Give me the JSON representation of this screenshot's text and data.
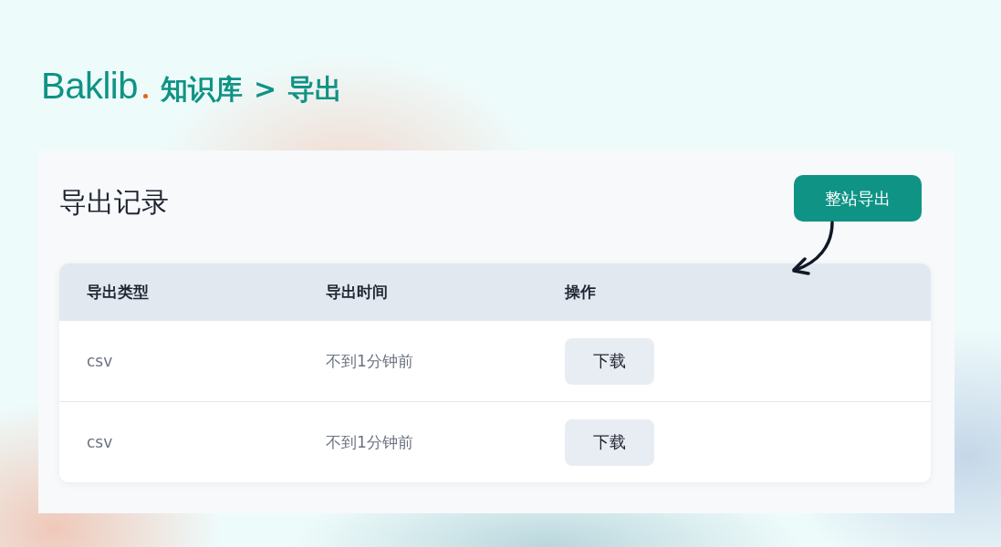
{
  "brand": {
    "logo": "Baklib",
    "breadcrumb": [
      "知识库",
      ">",
      "导出"
    ]
  },
  "panel": {
    "title": "导出记录",
    "export_button": "整站导出"
  },
  "table": {
    "columns": [
      "导出类型",
      "导出时间",
      "操作"
    ],
    "rows": [
      {
        "type": "csv",
        "time": "不到1分钟前",
        "action": "下载"
      },
      {
        "type": "csv",
        "time": "不到1分钟前",
        "action": "下载"
      }
    ]
  }
}
